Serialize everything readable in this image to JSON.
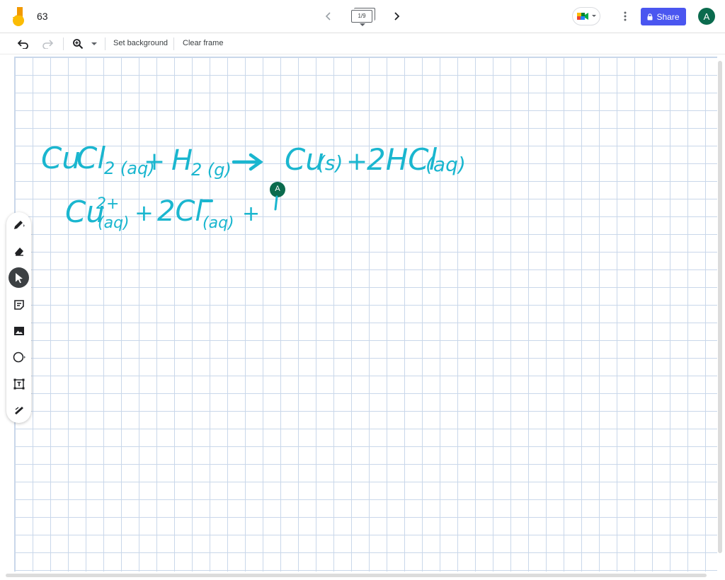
{
  "header": {
    "title": "63",
    "frame_counter": "1/9",
    "share_label": "Share",
    "avatar_initial": "A"
  },
  "toolbar": {
    "set_background_label": "Set background",
    "clear_frame_label": "Clear frame"
  },
  "canvas": {
    "ink_color": "#1ab6cf",
    "grid_color": "#c9d7ea",
    "collaborator_initial": "A",
    "collaborator_color": "#0b6b4e"
  },
  "tools": [
    "pen-icon",
    "eraser-icon",
    "select-icon",
    "sticky-note-icon",
    "image-icon",
    "circle-shape-icon",
    "text-box-icon",
    "laser-icon"
  ],
  "colors": {
    "accent": "#4a56f0",
    "avatar": "#0b6b4e",
    "ink": "#1ab6cf"
  }
}
